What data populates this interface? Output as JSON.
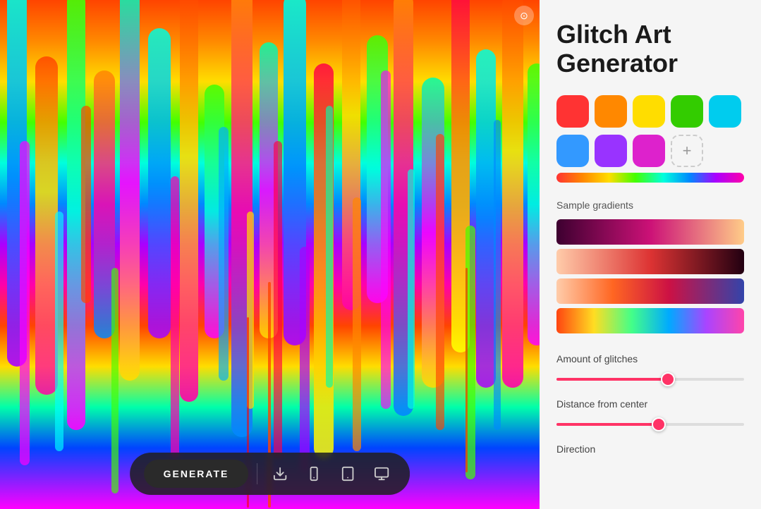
{
  "app": {
    "title_line1": "Glitch Art",
    "title_line2": "Generator"
  },
  "toolbar": {
    "generate_label": "GENERATE",
    "download_title": "Download",
    "mobile_title": "Mobile view",
    "tablet_title": "Tablet view",
    "desktop_title": "Desktop view"
  },
  "colors": {
    "swatches": [
      {
        "id": "c1",
        "value": "#ff3333",
        "label": "Red"
      },
      {
        "id": "c2",
        "value": "#ff8800",
        "label": "Orange"
      },
      {
        "id": "c3",
        "value": "#ffdd00",
        "label": "Yellow"
      },
      {
        "id": "c4",
        "value": "#33cc00",
        "label": "Green"
      },
      {
        "id": "c5",
        "value": "#00ccee",
        "label": "Cyan"
      },
      {
        "id": "c6",
        "value": "#3399ff",
        "label": "Blue"
      },
      {
        "id": "c7",
        "value": "#9933ff",
        "label": "Purple"
      },
      {
        "id": "c8",
        "value": "#dd22cc",
        "label": "Magenta"
      }
    ],
    "add_label": "+"
  },
  "gradient_bar": {
    "gradient": "linear-gradient(90deg, #ff3333 0%, #ff8800 14%, #ffdd00 28%, #44ff00 42%, #00ffdd 57%, #0088ff 71%, #aa00ff 85%, #ff00aa 100%)"
  },
  "sample_gradients": {
    "label": "Sample gradients",
    "items": [
      {
        "id": "sg1",
        "gradient": "linear-gradient(90deg, #3d0030 0%, #cc1177 50%, #ffcc88 100%)"
      },
      {
        "id": "sg2",
        "gradient": "linear-gradient(90deg, #ffccaa 0%, #dd3333 50%, #220011 100%)"
      },
      {
        "id": "sg3",
        "gradient": "linear-gradient(90deg, #ffccaa 0%, #ff6622 30%, #cc1144 60%, #3344aa 100%)"
      },
      {
        "id": "sg4",
        "gradient": "linear-gradient(90deg, #ff4411 0%, #ffdd22 20%, #44ff88 40%, #00aaff 60%, #aa44ff 80%, #ff44aa 100%)"
      }
    ]
  },
  "sliders": {
    "amount_label": "Amount of glitches",
    "amount_value": 60,
    "amount_pct": "60%",
    "distance_label": "Distance from center",
    "distance_value": 55,
    "distance_pct": "55%"
  },
  "direction": {
    "label": "Direction"
  }
}
